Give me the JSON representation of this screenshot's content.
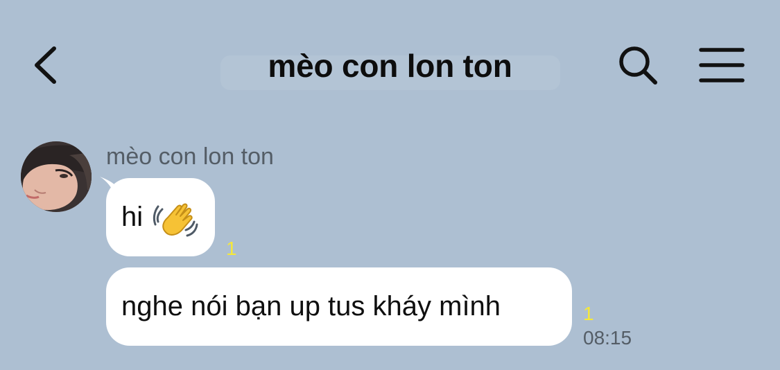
{
  "header": {
    "title": "mèo con lon ton",
    "back_icon": "chevron-left-icon",
    "search_icon": "search-icon",
    "menu_icon": "hamburger-menu-icon"
  },
  "chat": {
    "sender_name": "mèo con lon ton",
    "messages": [
      {
        "text": "hi",
        "emoji": "waving-hand",
        "unread": "1"
      },
      {
        "text": "nghe nói bạn up tus kháy mình",
        "unread": "1",
        "time": "08:15"
      }
    ]
  },
  "colors": {
    "background": "#adbfd2",
    "bubble": "#ffffff",
    "unread": "#f5e83a",
    "meta_text": "#545d66"
  }
}
